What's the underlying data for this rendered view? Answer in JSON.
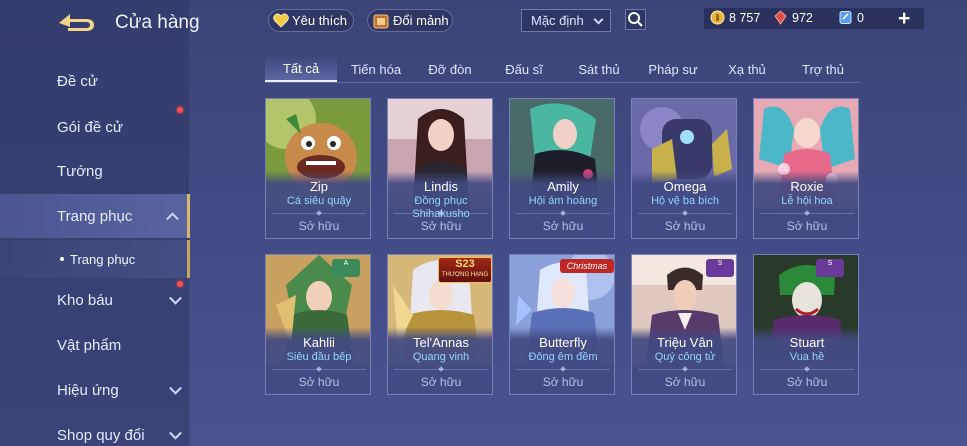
{
  "header": {
    "title": "Cửa hàng"
  },
  "sidebar": {
    "items": [
      {
        "label": "Đề cử"
      },
      {
        "label": "Gói đề cử"
      },
      {
        "label": "Tướng"
      },
      {
        "label": "Trang phục"
      },
      {
        "label": "Trang phục"
      },
      {
        "label": "Kho báu"
      },
      {
        "label": "Vật phẩm"
      },
      {
        "label": "Hiệu ứng"
      },
      {
        "label": "Shop quy đổi"
      }
    ]
  },
  "toolbar": {
    "favorite_label": "Yêu thích",
    "exchange_label": "Đổi mảnh",
    "sort_value": "Mặc định"
  },
  "currency": {
    "gold": "8 757",
    "gems": "972",
    "vouchers": "0"
  },
  "tabs": [
    "Tất cả",
    "Tiến hóa",
    "Đỡ đòn",
    "Đấu sĩ",
    "Sát thủ",
    "Pháp sư",
    "Xạ thủ",
    "Trợ thủ"
  ],
  "cards": [
    {
      "name": "Zip",
      "skin": "Cá siêu quậy",
      "status": "Sở hữu"
    },
    {
      "name": "Lindis",
      "skin": "Đồng phục Shihakusho",
      "status": "Sở hữu"
    },
    {
      "name": "Amily",
      "skin": "Hội ám hoàng",
      "status": "Sở hữu"
    },
    {
      "name": "Omega",
      "skin": "Hộ vệ ba bích",
      "status": "Sở hữu"
    },
    {
      "name": "Roxie",
      "skin": "Lễ hội hoa",
      "status": "Sở hữu"
    },
    {
      "name": "Kahlii",
      "skin": "Siêu đầu bếp",
      "status": "Sở hữu"
    },
    {
      "name": "Tel'Annas",
      "skin": "Quang vinh",
      "status": "Sở hữu"
    },
    {
      "name": "Butterfly",
      "skin": "Đông êm đềm",
      "status": "Sở hữu"
    },
    {
      "name": "Triệu Vân",
      "skin": "Quý công tử",
      "status": "Sở hữu"
    },
    {
      "name": "Stuart",
      "skin": "Vua hề",
      "status": "Sở hữu"
    }
  ],
  "badges": {
    "telannas_season": "S23",
    "telannas_rank": "THƯỢNG HẠNG",
    "butterfly_event": "Christmas"
  },
  "colors": {
    "accent_gold": "#d9b86a",
    "skin_name": "#8fd6ff",
    "background": "#434b86"
  }
}
